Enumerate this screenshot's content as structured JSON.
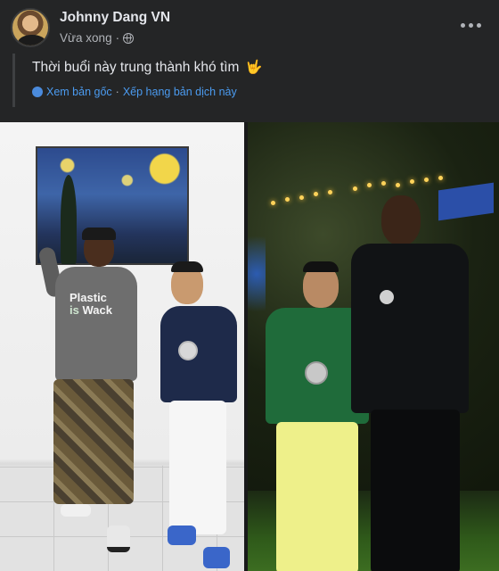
{
  "post": {
    "author": "Johnny Dang VN",
    "time": "Vừa xong",
    "privacy_icon": "globe-icon",
    "text": "Thời buổi này trung thành khó tìm",
    "emoji": "🤟",
    "translation": {
      "see_original": "Xem bản gốc",
      "separator": "·",
      "rate_translation": "Xếp hạng bản dịch này"
    }
  }
}
